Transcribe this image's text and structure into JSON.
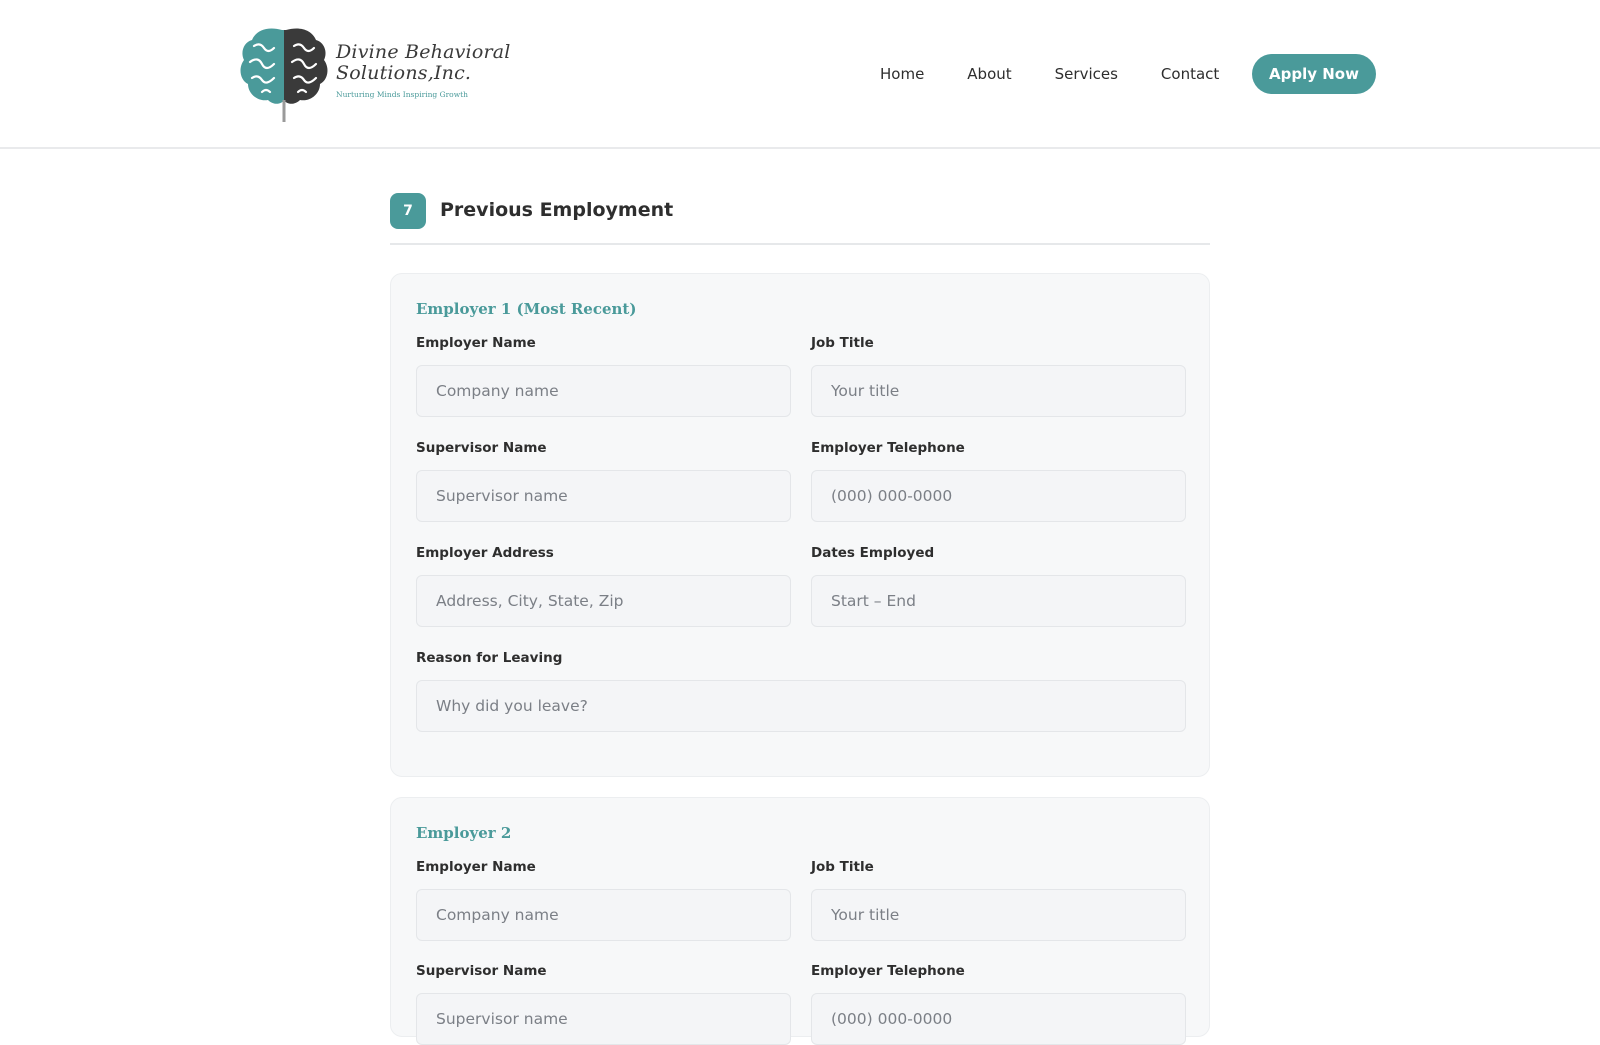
{
  "header": {
    "logo": {
      "line1": "Divine Behavioral",
      "line2": "Solutions,Inc.",
      "tagline": "Nurturing Minds Inspiring Growth"
    },
    "nav": {
      "home": "Home",
      "about": "About",
      "services": "Services",
      "contact": "Contact"
    },
    "apply_label": "Apply Now"
  },
  "section": {
    "step": "7",
    "title": "Previous Employment"
  },
  "employer1": {
    "title": "Employer 1 (Most Recent)",
    "employer_name": {
      "label": "Employer Name",
      "placeholder": "Company name"
    },
    "job_title": {
      "label": "Job Title",
      "placeholder": "Your title"
    },
    "supervisor_name": {
      "label": "Supervisor Name",
      "placeholder": "Supervisor name"
    },
    "employer_telephone": {
      "label": "Employer Telephone",
      "placeholder": "(000) 000-0000"
    },
    "employer_address": {
      "label": "Employer Address",
      "placeholder": "Address, City, State, Zip"
    },
    "dates_employed": {
      "label": "Dates Employed",
      "placeholder": "Start – End"
    },
    "reason_for_leaving": {
      "label": "Reason for Leaving",
      "placeholder": "Why did you leave?"
    }
  },
  "employer2": {
    "title": "Employer 2",
    "employer_name": {
      "label": "Employer Name",
      "placeholder": "Company name"
    },
    "job_title": {
      "label": "Job Title",
      "placeholder": "Your title"
    },
    "supervisor_name": {
      "label": "Supervisor Name",
      "placeholder": "Supervisor name"
    },
    "employer_telephone": {
      "label": "Employer Telephone",
      "placeholder": "(000) 000-0000"
    }
  },
  "colors": {
    "accent": "#4a9a9a",
    "card_background": "#f7f8f9",
    "text": "#2e2e2e"
  }
}
